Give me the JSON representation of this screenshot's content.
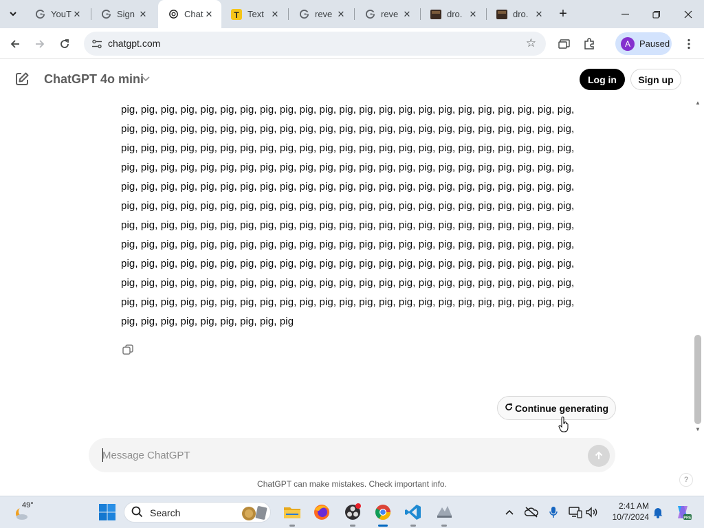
{
  "browser": {
    "tabs": [
      {
        "title": "YouT",
        "icon": "google-icon"
      },
      {
        "title": "Sign",
        "icon": "google-icon"
      },
      {
        "title": "Chat",
        "icon": "openai-icon",
        "active": true
      },
      {
        "title": "Text",
        "icon": "text-t-icon"
      },
      {
        "title": "reve",
        "icon": "google-icon"
      },
      {
        "title": "reve",
        "icon": "google-icon"
      },
      {
        "title": "dro.",
        "icon": "image-thumb-icon"
      },
      {
        "title": "dro.",
        "icon": "image-thumb-icon"
      }
    ],
    "url": "chatgpt.com",
    "profile_initial": "A",
    "profile_status": "Paused"
  },
  "header": {
    "model_title": "ChatGPT 4o mini",
    "login_label": "Log in",
    "signup_label": "Sign up"
  },
  "conversation": {
    "lines": [
      "pig, pig, pig, pig, pig, pig, pig, pig, pig, pig, pig, pig, pig, pig, pig, pig, pig, pig, pig, pig, pig, pig, pig,",
      "pig, pig, pig, pig, pig, pig, pig, pig, pig, pig, pig, pig, pig, pig, pig, pig, pig, pig, pig, pig, pig, pig, pig,",
      "pig, pig, pig, pig, pig, pig, pig, pig, pig, pig, pig, pig, pig, pig, pig, pig, pig, pig, pig, pig, pig, pig, pig,",
      "pig, pig, pig, pig, pig, pig, pig, pig, pig, pig, pig, pig, pig, pig, pig, pig, pig, pig, pig, pig, pig, pig, pig,",
      "pig, pig, pig, pig, pig, pig, pig, pig, pig, pig, pig, pig, pig, pig, pig, pig, pig, pig, pig, pig, pig, pig, pig,",
      "pig, pig, pig, pig, pig, pig, pig, pig, pig, pig, pig, pig, pig, pig, pig, pig, pig, pig, pig, pig, pig, pig, pig,",
      "pig, pig, pig, pig, pig, pig, pig, pig, pig, pig, pig, pig, pig, pig, pig, pig, pig, pig, pig, pig, pig, pig, pig,",
      "pig, pig, pig, pig, pig, pig, pig, pig, pig, pig, pig, pig, pig, pig, pig, pig, pig, pig, pig, pig, pig, pig, pig,",
      "pig, pig, pig, pig, pig, pig, pig, pig, pig, pig, pig, pig, pig, pig, pig, pig, pig, pig, pig, pig, pig, pig, pig,",
      "pig, pig, pig, pig, pig, pig, pig, pig, pig, pig, pig, pig, pig, pig, pig, pig, pig, pig, pig, pig, pig, pig, pig,",
      "pig, pig, pig, pig, pig, pig, pig, pig, pig, pig, pig, pig, pig, pig, pig, pig, pig, pig, pig, pig, pig, pig, pig,",
      "pig, pig, pig, pig, pig, pig, pig, pig, pig"
    ],
    "continue_label": "Continue generating"
  },
  "composer": {
    "placeholder": "Message ChatGPT",
    "value": ""
  },
  "footer": {
    "disclaimer": "ChatGPT can make mistakes. Check important info.",
    "help": "?"
  },
  "taskbar": {
    "temperature": "49°",
    "search_label": "Search",
    "time": "2:41 AM",
    "date": "10/7/2024",
    "apps": [
      "file-explorer-icon",
      "firefox-icon",
      "obs-icon",
      "chrome-icon",
      "vscode-icon",
      "app-icon"
    ],
    "tray": [
      "chevron-up-icon",
      "onedrive-icon",
      "microphone-icon",
      "display-icon",
      "speaker-icon",
      "notification-bell-icon",
      "copilot-icon"
    ]
  },
  "colors": {
    "tabstrip_bg": "#dde3ea",
    "profile_bg": "#d3e3fd",
    "profile_avatar": "#8430ce",
    "login_bg": "#000000",
    "taskbar_bg": "#e3e9f1",
    "accent_blue": "#0067c0"
  }
}
